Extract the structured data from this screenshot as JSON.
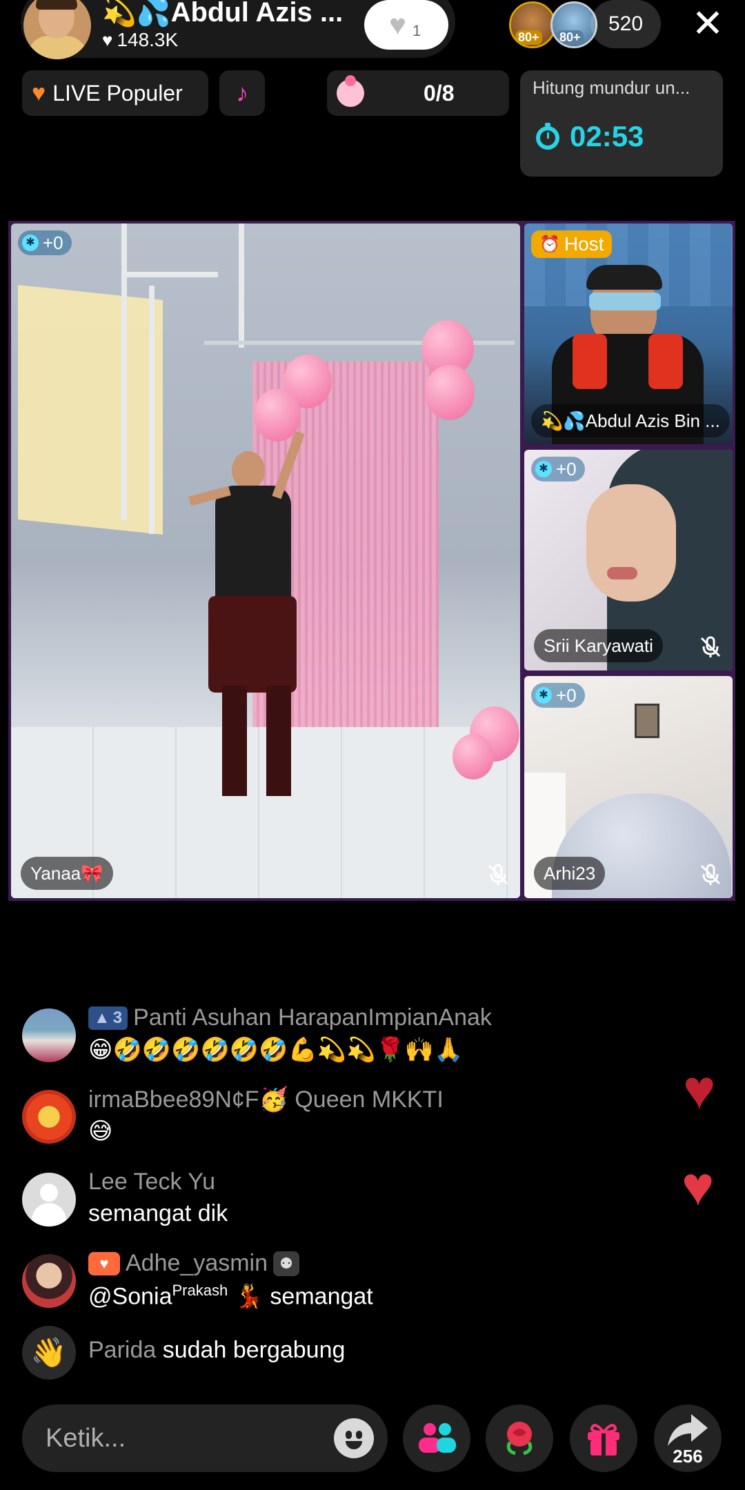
{
  "header": {
    "host_name": "💫💦Abdul Azis ...",
    "likes": "148.3K",
    "follow_count": "1",
    "viewer_badges": [
      "80+",
      "80+"
    ],
    "viewer_count": "520",
    "live_label": "LIVE Populer",
    "goal_progress": "0/8",
    "countdown_label": "Hitung mundur un...",
    "countdown_time": "02:53"
  },
  "tiles": {
    "main": {
      "score": "+0",
      "name": "Yanaa🎀"
    },
    "host": {
      "tag": "Host",
      "name": "💫💦Abdul Azis Bin ..."
    },
    "guest2": {
      "score": "+0",
      "name": "Srii Karyawati"
    },
    "guest3": {
      "score": "+0",
      "name": "Arhi23"
    }
  },
  "chat": [
    {
      "level": "3",
      "user": "Panti Asuhan HarapanImpianAnak",
      "text": "😁🤣🤣🤣🤣🤣🤣💪💫💫🌹🙌🙏"
    },
    {
      "user": "irmaBbee89N¢F🥳 Queen MKKTI",
      "text": "😅"
    },
    {
      "user": "Lee Teck Yu",
      "text": "semangat dik"
    },
    {
      "user": "Adhe_yasmin",
      "mention": "@Sonia",
      "mention_sup": "Prakash",
      "text": "💃 semangat"
    },
    {
      "user": "Parida",
      "text": "sudah bergabung"
    }
  ],
  "footer": {
    "input_placeholder": "Ketik...",
    "share_count": "256"
  },
  "colors": {
    "countdown": "#27d4e6",
    "host_tag": "#f2a900",
    "heart": "#e53845",
    "grid_border": "#3a1a4f"
  }
}
